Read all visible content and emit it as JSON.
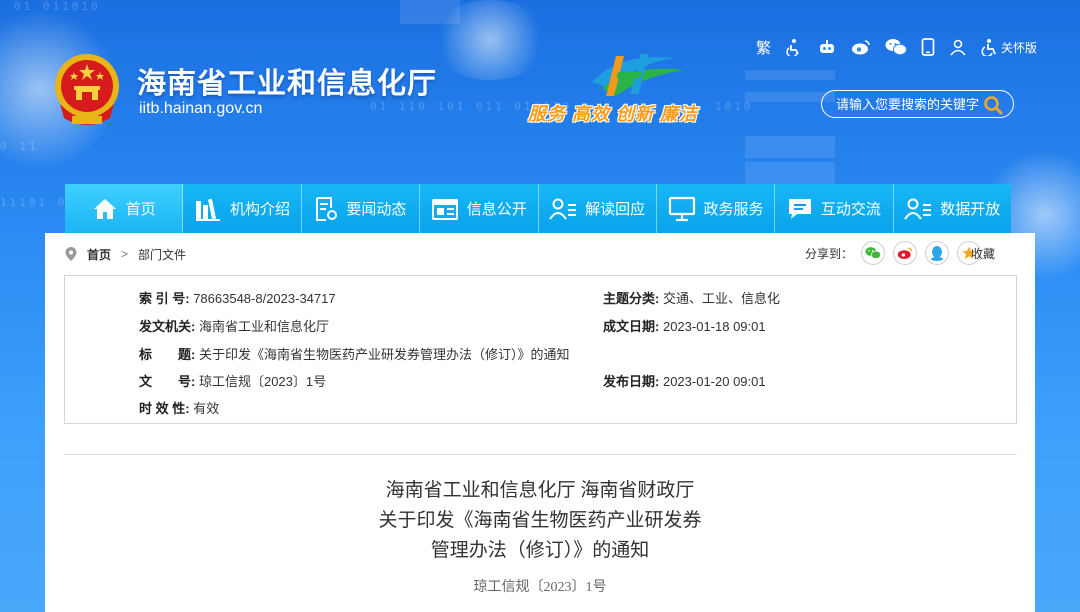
{
  "header": {
    "site_title": "海南省工业和信息化厅",
    "site_domain": "iitb.hainan.gov.cn",
    "slogan": "服务 高效 创新 廉洁",
    "tools": {
      "traditional_label": "繁",
      "care_label": "关怀版"
    },
    "search": {
      "placeholder": "请输入您要搜索的关键字"
    }
  },
  "nav": {
    "items": [
      {
        "label": "首页",
        "icon": "home-icon"
      },
      {
        "label": "机构介绍",
        "icon": "organization-icon"
      },
      {
        "label": "要闻动态",
        "icon": "news-icon"
      },
      {
        "label": "信息公开",
        "icon": "info-open-icon"
      },
      {
        "label": "解读回应",
        "icon": "interpret-icon"
      },
      {
        "label": "政务服务",
        "icon": "monitor-icon"
      },
      {
        "label": "互动交流",
        "icon": "chat-icon"
      },
      {
        "label": "数据开放",
        "icon": "data-open-icon"
      }
    ]
  },
  "breadcrumb": {
    "home": "首页",
    "separator": ">",
    "current": "部门文件"
  },
  "share": {
    "label": "分享到：",
    "favorite": "收藏"
  },
  "meta": {
    "index_no": {
      "key": "索 引 号:",
      "value": "78663548-8/2023-34717"
    },
    "subject": {
      "key": "主题分类:",
      "value": "交通、工业、信息化"
    },
    "issuer": {
      "key": "发文机关:",
      "value": "海南省工业和信息化厅"
    },
    "created": {
      "key": "成文日期:",
      "value": "2023-01-18 09:01"
    },
    "title": {
      "key": "标　　题:",
      "value": "关于印发《海南省生物医药产业研发券管理办法（修订）》的通知"
    },
    "doc_no": {
      "key": "文　　号:",
      "value": "琼工信规〔2023〕1号"
    },
    "published": {
      "key": "发布日期:",
      "value": "2023-01-20 09:01"
    },
    "validity": {
      "key": "时 效 性:",
      "value": "有效"
    }
  },
  "document": {
    "title_lines": [
      "海南省工业和信息化厅  海南省财政厅",
      "关于印发《海南省生物医药产业研发券",
      "管理办法（修订）》的通知"
    ],
    "number": "琼工信规〔2023〕1号"
  },
  "colors": {
    "nav_bg": "#0aa2ec",
    "slogan": "#ff9c1a",
    "search_icon": "#f5a623"
  }
}
